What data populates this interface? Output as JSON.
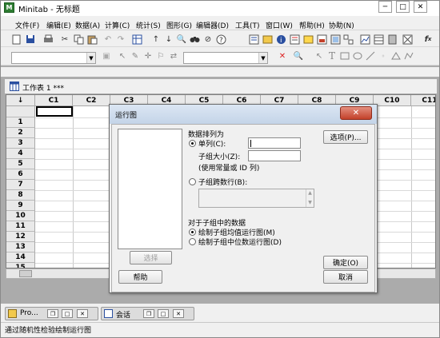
{
  "window": {
    "title": "Minitab - 无标题",
    "min": "─",
    "max": "□",
    "close": "✕"
  },
  "menubar": [
    "文件(F)",
    "编辑(E)",
    "数据(A)",
    "计算(C)",
    "统计(S)",
    "图形(G)",
    "编辑器(D)",
    "工具(T)",
    "窗口(W)",
    "帮助(H)",
    "协助(N)"
  ],
  "worksheet": {
    "title": "工作表 1 ***",
    "columns": [
      "C1",
      "C2",
      "C3",
      "C4",
      "C5",
      "C6",
      "C7",
      "C8",
      "C9",
      "C10",
      "C11"
    ],
    "rows": [
      "1",
      "2",
      "3",
      "4",
      "5",
      "6",
      "7",
      "8",
      "9",
      "10",
      "11",
      "12",
      "13",
      "14",
      "15"
    ],
    "corner": "↓"
  },
  "dialog": {
    "title": "运行图",
    "close": "✕",
    "data_arrangement": "数据排列为",
    "single_column": "单列(C):",
    "subgroup_size": "子组大小(Z):",
    "subgroup_hint": "(使用常量或 ID 列)",
    "subgroups_across_rows": "子组跨数行(B):",
    "subgroup_data": "对于子组中的数据",
    "plot_means": "绘制子组均值运行图(M)",
    "plot_medians": "绘制子组中位数运行图(D)",
    "options_button": "选项(P)...",
    "select_button": "选择",
    "help_button": "帮助",
    "ok_button": "确定(O)",
    "cancel_button": "取消"
  },
  "taskbar": {
    "project_tab": "Pro...",
    "session_tab": "会话"
  },
  "status_text": "通过随机性检验绘制运行图",
  "colors": {
    "dialog_close": "#c3412a",
    "mdi_background": "#ababab"
  },
  "icons": [
    "new-icon",
    "open-icon",
    "save-icon",
    "print-icon",
    "cut-icon",
    "copy-icon",
    "paste-icon",
    "undo-icon",
    "redo-icon",
    "find-icon",
    "help-icon",
    "arrow-icon",
    "text-icon",
    "rectangle-icon",
    "ellipse-icon",
    "line-icon"
  ]
}
